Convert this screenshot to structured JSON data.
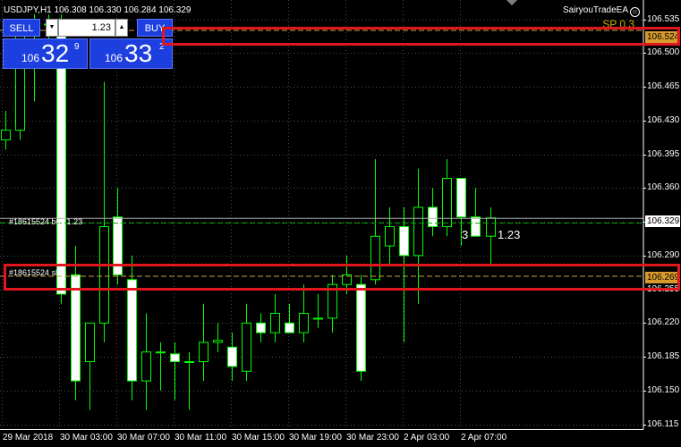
{
  "chart_header": {
    "symbol_info": "USDJPY,H1  106.308 106.330 106.284 106.329",
    "ea_name": "SairyouTradeEA",
    "smiley": "☺",
    "spread_label": "SP 0.3"
  },
  "trade_panel": {
    "sell_label": "SELL",
    "buy_label": "BUY",
    "volume_value": "1.23",
    "dropdown_icon": "▼",
    "increment_icon": "▲",
    "sell_price_prefix": "106",
    "sell_price_big": "32",
    "sell_price_sup": "9",
    "buy_price_prefix": "106",
    "buy_price_big": "33",
    "buy_price_sup": "2"
  },
  "price_axis": {
    "ticks": [
      "106.535",
      "106.500",
      "106.465",
      "106.430",
      "106.395",
      "106.360",
      "106.325",
      "106.290",
      "106.255",
      "106.220",
      "106.185",
      "106.150",
      "106.115"
    ],
    "tags": {
      "tp": "106.524",
      "bid": "106.329",
      "sl": "106.269"
    }
  },
  "time_axis": {
    "ticks": [
      "29 Mar 2018",
      "30 Mar 03:00",
      "30 Mar 07:00",
      "30 Mar 11:00",
      "30 Mar 15:00",
      "30 Mar 19:00",
      "30 Mar 23:00",
      "2 Apr 03:00",
      "2 Apr 07:00"
    ]
  },
  "order_lines": {
    "entry_label": "#18615524 buy 1.23",
    "sl_label": "#18615524 sl",
    "volume_marker_left": "3",
    "volume_marker_right": "1.23"
  },
  "chart_data": {
    "type": "candlestick",
    "symbol": "USDJPY",
    "timeframe": "H1",
    "ylim": [
      106.11,
      106.555
    ],
    "levels": {
      "entry": 106.324,
      "bid": 106.329,
      "take_profit": 106.524,
      "stop_loss": 106.269
    },
    "candles": [
      {
        "x": 6,
        "o": 106.41,
        "h": 106.44,
        "l": 106.4,
        "c": 106.42
      },
      {
        "x": 22,
        "o": 106.42,
        "h": 106.52,
        "l": 106.41,
        "c": 106.52
      },
      {
        "x": 38,
        "o": 106.52,
        "h": 106.54,
        "l": 106.45,
        "c": 106.53
      },
      {
        "x": 54,
        "o": 106.53,
        "h": 106.54,
        "l": 106.5,
        "c": 106.53
      },
      {
        "x": 68,
        "o": 106.52,
        "h": 106.54,
        "l": 106.24,
        "c": 106.25
      },
      {
        "x": 84,
        "o": 106.27,
        "h": 106.3,
        "l": 106.14,
        "c": 106.16
      },
      {
        "x": 100,
        "o": 106.18,
        "h": 106.22,
        "l": 106.13,
        "c": 106.22
      },
      {
        "x": 116,
        "o": 106.22,
        "h": 106.47,
        "l": 106.2,
        "c": 106.32
      },
      {
        "x": 131,
        "o": 106.33,
        "h": 106.36,
        "l": 106.26,
        "c": 106.27
      },
      {
        "x": 147,
        "o": 106.265,
        "h": 106.29,
        "l": 106.14,
        "c": 106.16
      },
      {
        "x": 163,
        "o": 106.16,
        "h": 106.23,
        "l": 106.13,
        "c": 106.19
      },
      {
        "x": 179,
        "o": 106.19,
        "h": 106.2,
        "l": 106.15,
        "c": 106.19
      },
      {
        "x": 195,
        "o": 106.188,
        "h": 106.2,
        "l": 106.14,
        "c": 106.18
      },
      {
        "x": 211,
        "o": 106.18,
        "h": 106.19,
        "l": 106.13,
        "c": 106.18
      },
      {
        "x": 227,
        "o": 106.18,
        "h": 106.24,
        "l": 106.16,
        "c": 106.2
      },
      {
        "x": 243,
        "o": 106.2,
        "h": 106.22,
        "l": 106.19,
        "c": 106.202
      },
      {
        "x": 259,
        "o": 106.195,
        "h": 106.21,
        "l": 106.16,
        "c": 106.175
      },
      {
        "x": 275,
        "o": 106.17,
        "h": 106.24,
        "l": 106.16,
        "c": 106.22
      },
      {
        "x": 291,
        "o": 106.22,
        "h": 106.23,
        "l": 106.2,
        "c": 106.21
      },
      {
        "x": 307,
        "o": 106.21,
        "h": 106.25,
        "l": 106.2,
        "c": 106.23
      },
      {
        "x": 323,
        "o": 106.22,
        "h": 106.24,
        "l": 106.21,
        "c": 106.21
      },
      {
        "x": 339,
        "o": 106.21,
        "h": 106.26,
        "l": 106.2,
        "c": 106.23
      },
      {
        "x": 355,
        "o": 106.225,
        "h": 106.25,
        "l": 106.215,
        "c": 106.225
      },
      {
        "x": 371,
        "o": 106.225,
        "h": 106.27,
        "l": 106.21,
        "c": 106.26
      },
      {
        "x": 387,
        "o": 106.26,
        "h": 106.29,
        "l": 106.25,
        "c": 106.27
      },
      {
        "x": 403,
        "o": 106.26,
        "h": 106.27,
        "l": 106.16,
        "c": 106.17
      },
      {
        "x": 419,
        "o": 106.265,
        "h": 106.39,
        "l": 106.26,
        "c": 106.31
      },
      {
        "x": 435,
        "o": 106.3,
        "h": 106.34,
        "l": 106.28,
        "c": 106.32
      },
      {
        "x": 451,
        "o": 106.32,
        "h": 106.34,
        "l": 106.2,
        "c": 106.29
      },
      {
        "x": 467,
        "o": 106.29,
        "h": 106.38,
        "l": 106.24,
        "c": 106.34
      },
      {
        "x": 483,
        "o": 106.34,
        "h": 106.36,
        "l": 106.31,
        "c": 106.32
      },
      {
        "x": 499,
        "o": 106.32,
        "h": 106.39,
        "l": 106.31,
        "c": 106.37
      },
      {
        "x": 515,
        "o": 106.37,
        "h": 106.37,
        "l": 106.3,
        "c": 106.33
      },
      {
        "x": 531,
        "o": 106.33,
        "h": 106.36,
        "l": 106.31,
        "c": 106.31
      },
      {
        "x": 548,
        "o": 106.31,
        "h": 106.34,
        "l": 106.28,
        "c": 106.329
      }
    ]
  }
}
